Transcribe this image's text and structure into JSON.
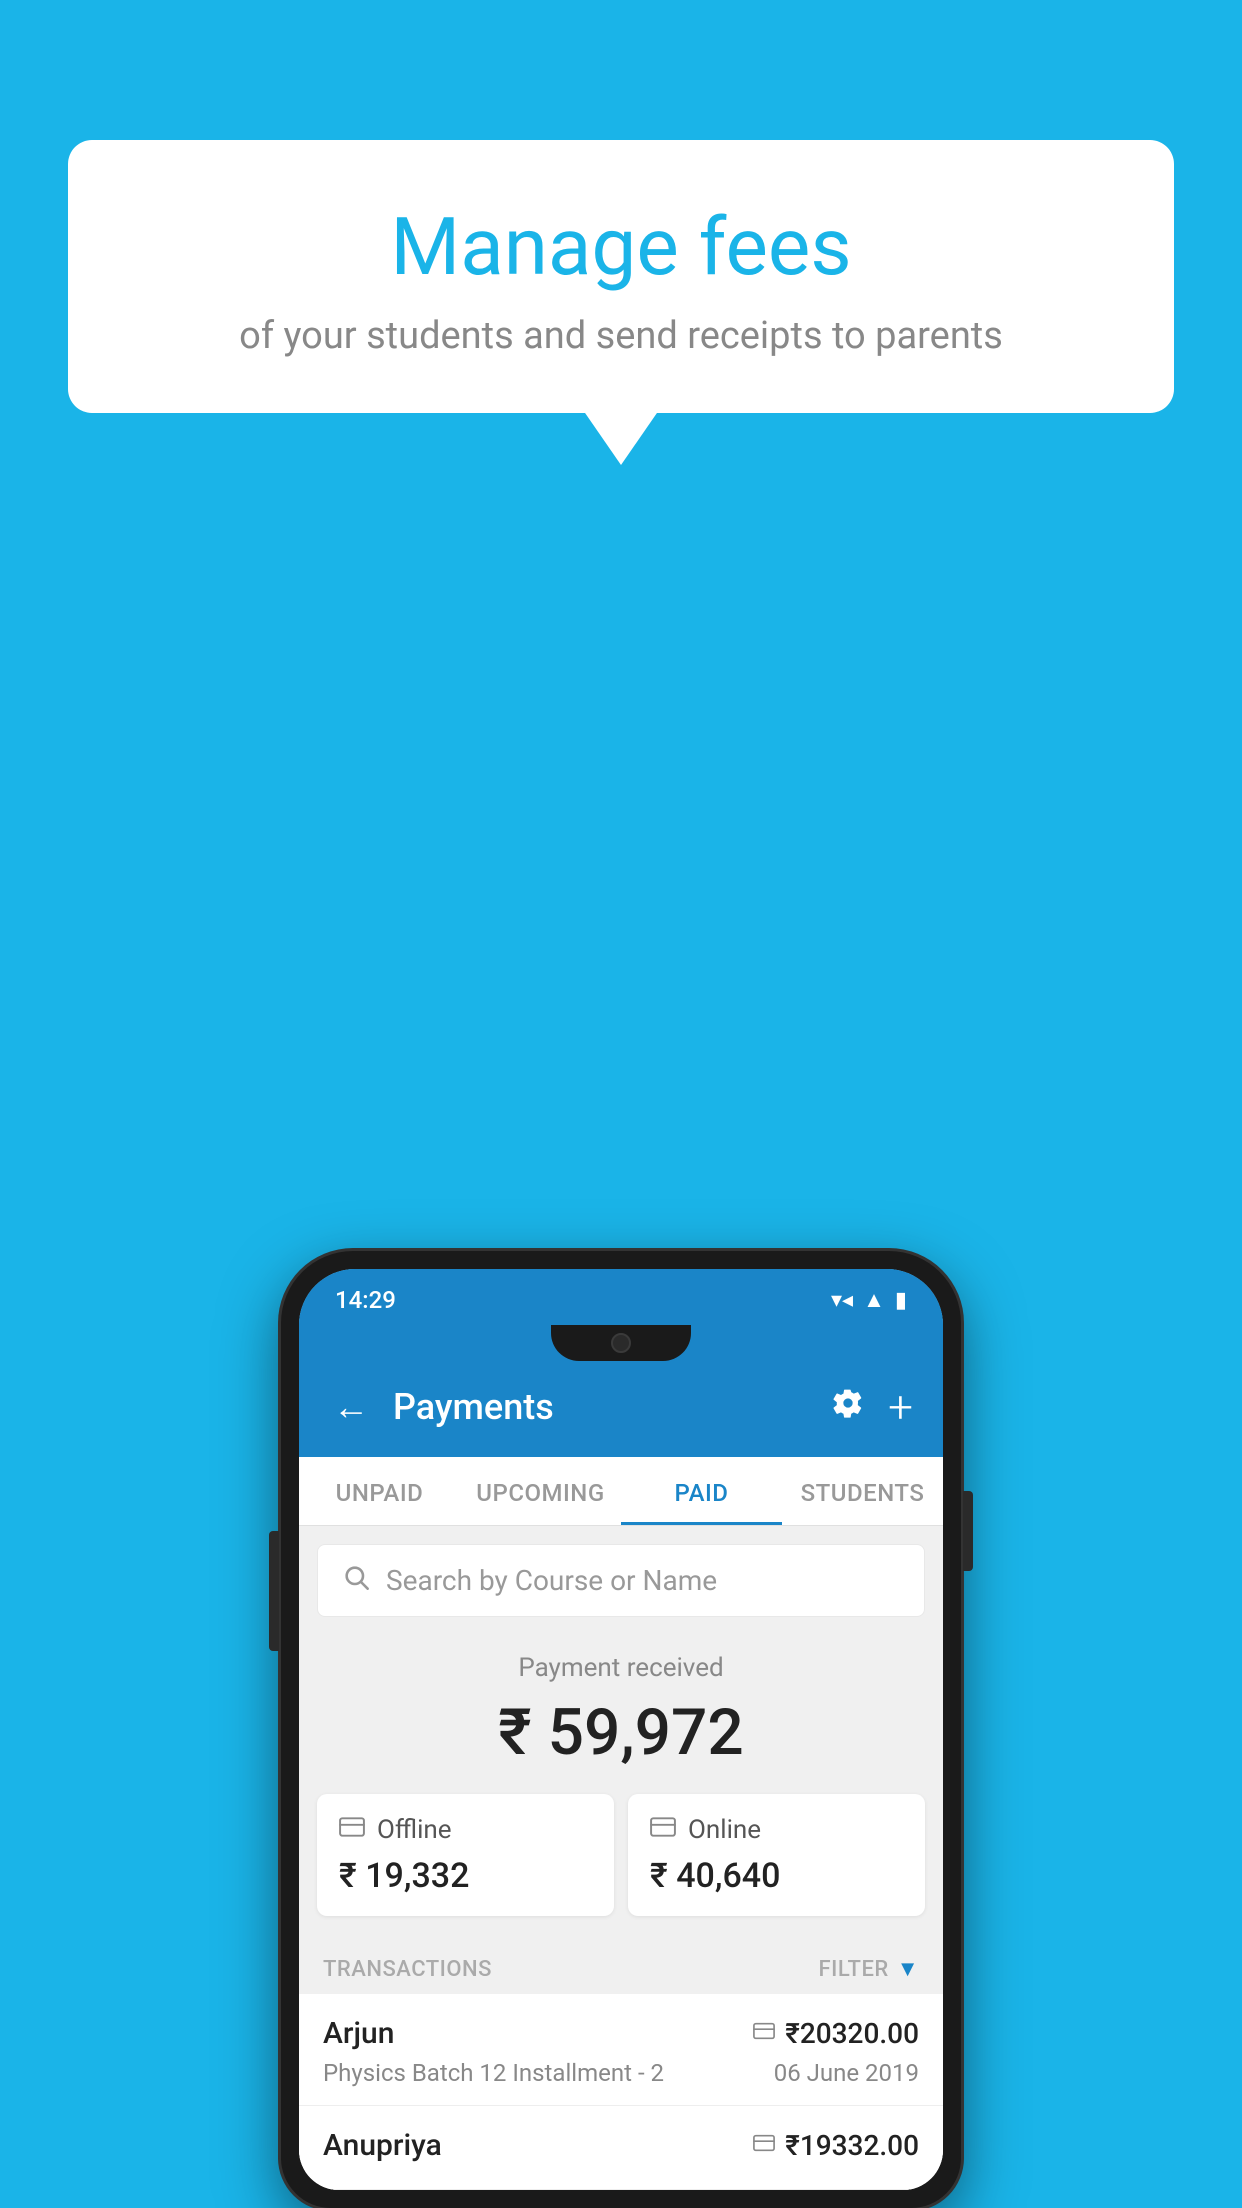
{
  "background_color": "#1ab4e8",
  "speech_bubble": {
    "title": "Manage fees",
    "subtitle": "of your students and send receipts to parents"
  },
  "phone": {
    "status_bar": {
      "time": "14:29",
      "wifi": "▼",
      "signal": "▲",
      "battery": "▮"
    },
    "header": {
      "title": "Payments",
      "back_label": "←",
      "gear_label": "⚙",
      "plus_label": "+"
    },
    "tabs": [
      {
        "label": "UNPAID",
        "active": false
      },
      {
        "label": "UPCOMING",
        "active": false
      },
      {
        "label": "PAID",
        "active": true
      },
      {
        "label": "STUDENTS",
        "active": false
      }
    ],
    "search": {
      "placeholder": "Search by Course or Name"
    },
    "payment_summary": {
      "label": "Payment received",
      "amount": "₹ 59,972"
    },
    "payment_cards": [
      {
        "type": "Offline",
        "amount": "₹ 19,332"
      },
      {
        "type": "Online",
        "amount": "₹ 40,640"
      }
    ],
    "transactions_section": {
      "label": "TRANSACTIONS",
      "filter_label": "FILTER"
    },
    "transactions": [
      {
        "name": "Arjun",
        "mode": "card",
        "amount": "₹20320.00",
        "course": "Physics Batch 12 Installment - 2",
        "date": "06 June 2019"
      },
      {
        "name": "Anupriya",
        "mode": "cash",
        "amount": "₹19332.00",
        "course": "",
        "date": ""
      }
    ]
  }
}
